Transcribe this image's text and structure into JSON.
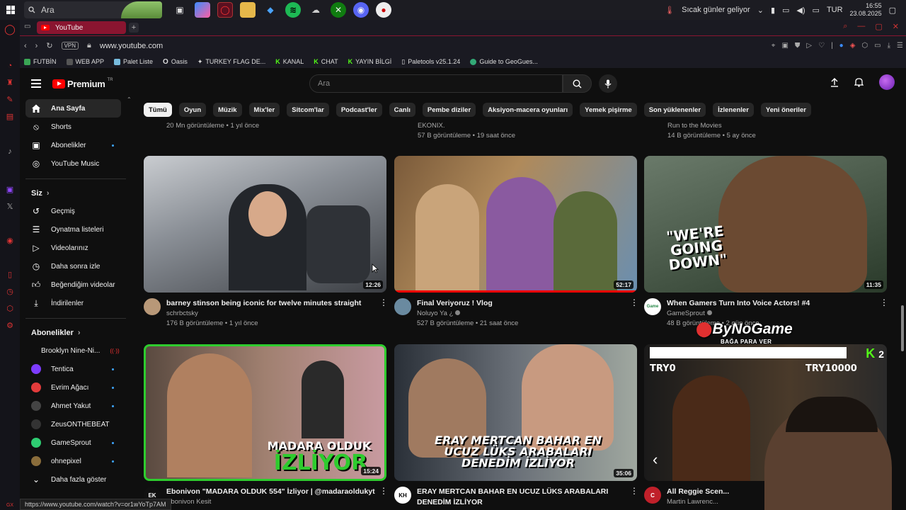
{
  "taskbar": {
    "search_placeholder": "Ara",
    "weather": "Sıcak günler geliyor",
    "lang": "TUR",
    "time": "16:55",
    "date": "23.08.2025"
  },
  "browser": {
    "tab_title": "YouTube",
    "vpn": "VPN",
    "url": "www.youtube.com",
    "status_url": "https://www.youtube.com/watch?v=or1wYoTp7AM",
    "bookmarks": [
      "FUTBİN",
      "WEB APP",
      "Palet Liste",
      "Oasis",
      "TURKEY FLAG DE...",
      "KANAL",
      "CHAT",
      "YAYIN BİLGİ",
      "Paletools v25.1.24",
      "Guide to GeoGues..."
    ]
  },
  "youtube": {
    "logo": "Premium",
    "logo_sup": "TR",
    "search_placeholder": "Ara"
  },
  "sidebar": {
    "main": [
      {
        "label": "Ana Sayfa",
        "icon": "home-icon"
      },
      {
        "label": "Shorts",
        "icon": "shorts-icon"
      },
      {
        "label": "Abonelikler",
        "icon": "subscriptions-icon"
      },
      {
        "label": "YouTube Music",
        "icon": "music-icon"
      }
    ],
    "you_header": "Siz",
    "you": [
      {
        "label": "Geçmiş",
        "icon": "history-icon"
      },
      {
        "label": "Oynatma listeleri",
        "icon": "playlist-icon"
      },
      {
        "label": "Videolarınız",
        "icon": "your-videos-icon"
      },
      {
        "label": "Daha sonra izle",
        "icon": "watch-later-icon"
      },
      {
        "label": "Beğendiğim videolar",
        "icon": "like-icon"
      },
      {
        "label": "İndirilenler",
        "icon": "download-icon"
      }
    ],
    "subs_header": "Abonelikler",
    "subs": [
      {
        "label": "Brooklyn Nine-Ni...",
        "color": "#c9a227"
      },
      {
        "label": "Tentica",
        "color": "#7d3cff"
      },
      {
        "label": "Evrim Ağacı",
        "color": "#e23b3b"
      },
      {
        "label": "Ahmet Yakut",
        "color": "#444444"
      },
      {
        "label": "ZeusONTHEBEAT",
        "color": "#333333"
      },
      {
        "label": "GameSprout",
        "color": "#2ecc71"
      },
      {
        "label": "ohnepixel",
        "color": "#8a6d3b"
      }
    ],
    "more": "Daha fazla göster"
  },
  "chips": [
    "Tümü",
    "Oyun",
    "Müzik",
    "Mix'ler",
    "Sitcom'lar",
    "Podcast'ler",
    "Canlı",
    "Pembe diziler",
    "Aksiyon-macera oyunları",
    "Yemek pişirme",
    "Son yüklenenler",
    "İzlenenler",
    "Yeni öneriler"
  ],
  "top_row": [
    {
      "channel": "",
      "meta": "20 Mn görüntüleme • 1 yıl önce"
    },
    {
      "channel": "EKONIX.",
      "meta": "57 B görüntüleme • 19 saat önce"
    },
    {
      "channel": "Run to the Movies",
      "meta": "14 B görüntüleme • 5 ay önce"
    }
  ],
  "videos": [
    {
      "title": "barney stinson being iconic for twelve minutes straight",
      "channel": "schrbctsky",
      "meta": "176 B görüntüleme • 1 yıl önce",
      "duration": "12:26",
      "watched": 0
    },
    {
      "title": "Final Veriyoruz ! Vlog",
      "channel": "Noluyo Ya ¿",
      "meta": "527 B görüntüleme • 21 saat önce",
      "duration": "52:17",
      "watched": 1.0
    },
    {
      "title": "When Gamers Turn Into Voice Actors! #4",
      "channel": "GameSprout",
      "meta": "48 B görüntüleme • 2 gün önce",
      "duration": "11:35",
      "watched": 0,
      "thumb_text": "\"WE'RE GOING DOWN\"",
      "av_text": "Game"
    },
    {
      "title": "Ebonivon \"MADARA OLDUK 554\" İzliyor | @madaraoldukyt",
      "channel": "Ebonivon Kesit",
      "meta": "",
      "duration": "15:24",
      "watched": 0,
      "thumb_text1": "MADARA OLDUK",
      "thumb_text2": "İZLİYOR",
      "av_text": "EK"
    },
    {
      "title": "ERAY MERTCAN BAHAR EN UCUZ LÜKS ARABALARI DENEDİM İZLİYOR",
      "channel": "",
      "meta": "",
      "duration": "35:06",
      "watched": 0,
      "thumb_text": "ERAY MERTCAN BAHAR EN UCUZ LÜKS ARABALARI DENEDİM İZLİYOR",
      "av_text": "KH"
    },
    {
      "title": "All Reggie Scen...",
      "channel": "Martin Lawrenc...",
      "meta": "",
      "duration": "",
      "watched": 0,
      "thumb_left": "TRY0",
      "thumb_right": "TRY10000",
      "badge": "2",
      "av_text": "C"
    }
  ],
  "overlay": {
    "brand": "ByNoGame",
    "slogan": "BAĞA PARA VER"
  }
}
